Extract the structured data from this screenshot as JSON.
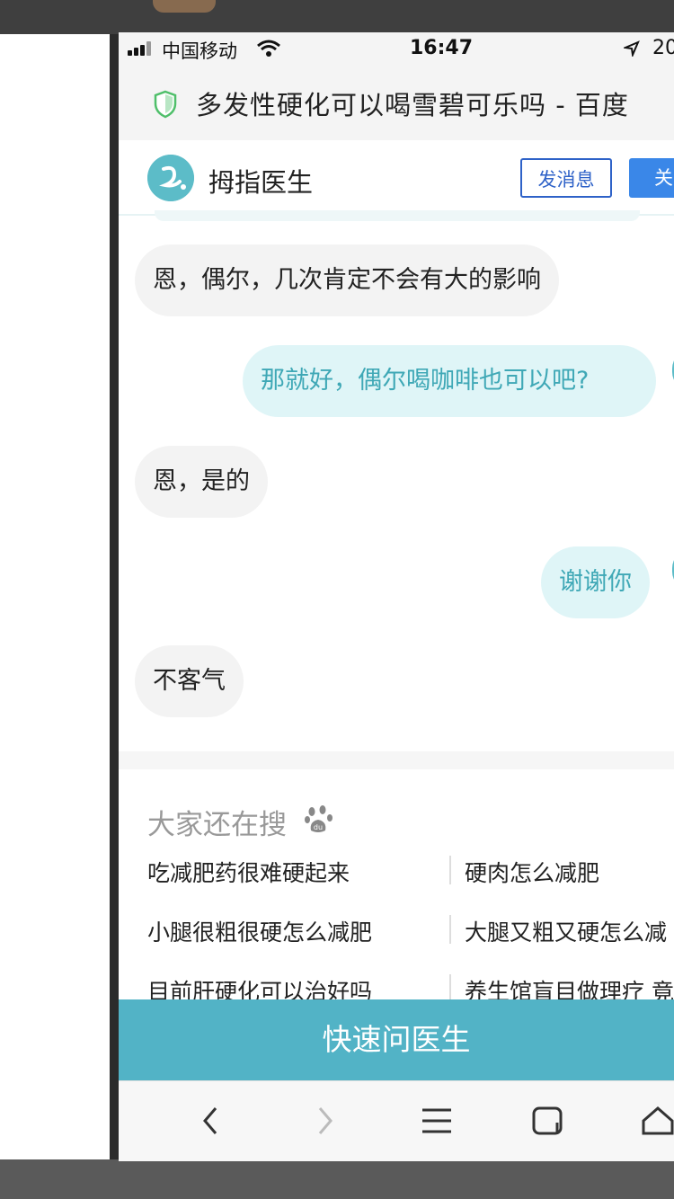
{
  "status_bar": {
    "carrier": "中国移动",
    "time": "16:47",
    "battery_partial": "20"
  },
  "browser": {
    "title": "多发性硬化可以喝雪碧可乐吗 - 百度"
  },
  "doctor_header": {
    "name": "拇指医生",
    "message_button": "发消息",
    "follow_button_partial": "关"
  },
  "chat": {
    "messages": [
      {
        "side": "in",
        "text": "恩，偶尔，几次肯定不会有大的影响"
      },
      {
        "side": "out",
        "text": "那就好，偶尔喝咖啡也可以吧?"
      },
      {
        "side": "in",
        "text": "恩，是的"
      },
      {
        "side": "out",
        "text": "谢谢你"
      },
      {
        "side": "in",
        "text": "不客气"
      }
    ]
  },
  "related": {
    "title": "大家还在搜",
    "items": [
      [
        "吃减肥药很难硬起来",
        "硬肉怎么减肥"
      ],
      [
        "小腿很粗很硬怎么减肥",
        "大腿又粗又硬怎么减"
      ],
      [
        "目前肝硬化可以治好吗",
        "养生馆盲目做理疗 竟"
      ]
    ]
  },
  "cta": {
    "label": "快速问医生"
  },
  "toolbar": {
    "icons": [
      "back-icon",
      "forward-icon",
      "menu-icon",
      "tabs-icon",
      "home-icon"
    ]
  },
  "colors": {
    "accent": "#52b3c6",
    "user_bubble_text": "#3fa8b6",
    "follow_blue": "#3a87e8"
  }
}
